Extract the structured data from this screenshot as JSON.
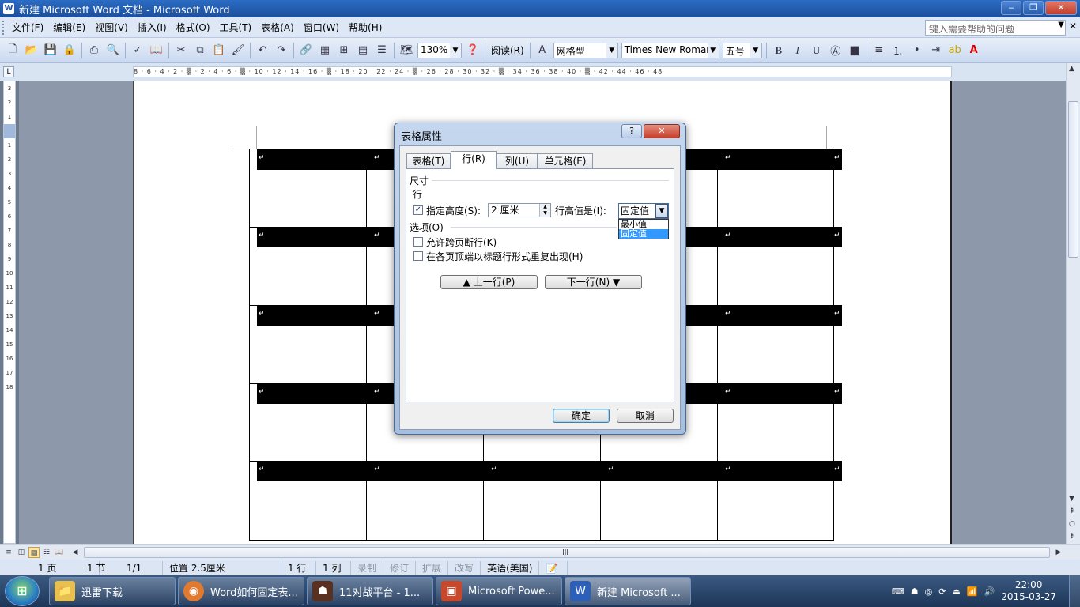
{
  "window": {
    "title": "新建 Microsoft Word 文档 - Microsoft Word",
    "minimize": "‒",
    "maximize": "❐",
    "close": "✕"
  },
  "menu": {
    "items": [
      "文件(F)",
      "编辑(E)",
      "视图(V)",
      "插入(I)",
      "格式(O)",
      "工具(T)",
      "表格(A)",
      "窗口(W)",
      "帮助(H)"
    ],
    "help_search_placeholder": "键入需要帮助的问题",
    "close_doc": "✕"
  },
  "toolbar": {
    "zoom": "130%",
    "read_label": "阅读(R)",
    "style": "网格型",
    "font": "Times New Roman",
    "size": "五号",
    "bold": "B",
    "italic": "I",
    "underline": "U"
  },
  "ruler": {
    "horizontal_ticks": "8 · 6 · 4 · 2 · ▒ · 2 · 4 · 6 · ▒ · 10 · 12 · 14 · 16 · ▒ · 18 · 20 · 22 · 24 · ▒ · 26 · 28 · 30 · 32 · ▒ · 34 · 36 · 38 · 40 · ▒ · 42 · 44 · 46 · 48",
    "vertical_ticks": [
      "3",
      "2",
      "1",
      "",
      "1",
      "2",
      "3",
      "4",
      "5",
      "6",
      "7",
      "8",
      "9",
      "10",
      "11",
      "12",
      "13",
      "14",
      "15",
      "16",
      "17",
      "18"
    ]
  },
  "document": {
    "cell_mark": "↵"
  },
  "dialog": {
    "title": "表格属性",
    "help": "?",
    "close": "✕",
    "tabs": [
      "表格(T)",
      "行(R)",
      "列(U)",
      "单元格(E)"
    ],
    "active_tab": "行(R)",
    "size_group": "尺寸",
    "row_label": "行",
    "specify_height_label": "指定高度(S):",
    "specify_height_checked": true,
    "height_value": "2 厘米",
    "row_height_is_label": "行高值是(I):",
    "row_height_type": "固定值",
    "row_height_options": [
      "最小值",
      "固定值"
    ],
    "options_group": "选项(O)",
    "allow_break_label": "允许跨页断行(K)",
    "repeat_header_label": "在各页顶端以标题行形式重复出现(H)",
    "prev_row": "上一行(P)",
    "next_row": "下一行(N)",
    "ok": "确定",
    "cancel": "取消"
  },
  "status": {
    "page": "1 页",
    "section": "1 节",
    "page_of": "1/1",
    "position": "位置 2.5厘米",
    "line": "1 行",
    "column": "1 列",
    "rec": "录制",
    "trk": "修订",
    "ext": "扩展",
    "ovr": "改写",
    "language": "英语(美国)"
  },
  "taskbar": {
    "buttons": [
      "迅雷下载",
      "Word如何固定表...",
      "11对战平台 - 1...",
      "Microsoft Powe...",
      "新建 Microsoft ..."
    ],
    "time": "22:00",
    "date": "2015-03-27"
  }
}
